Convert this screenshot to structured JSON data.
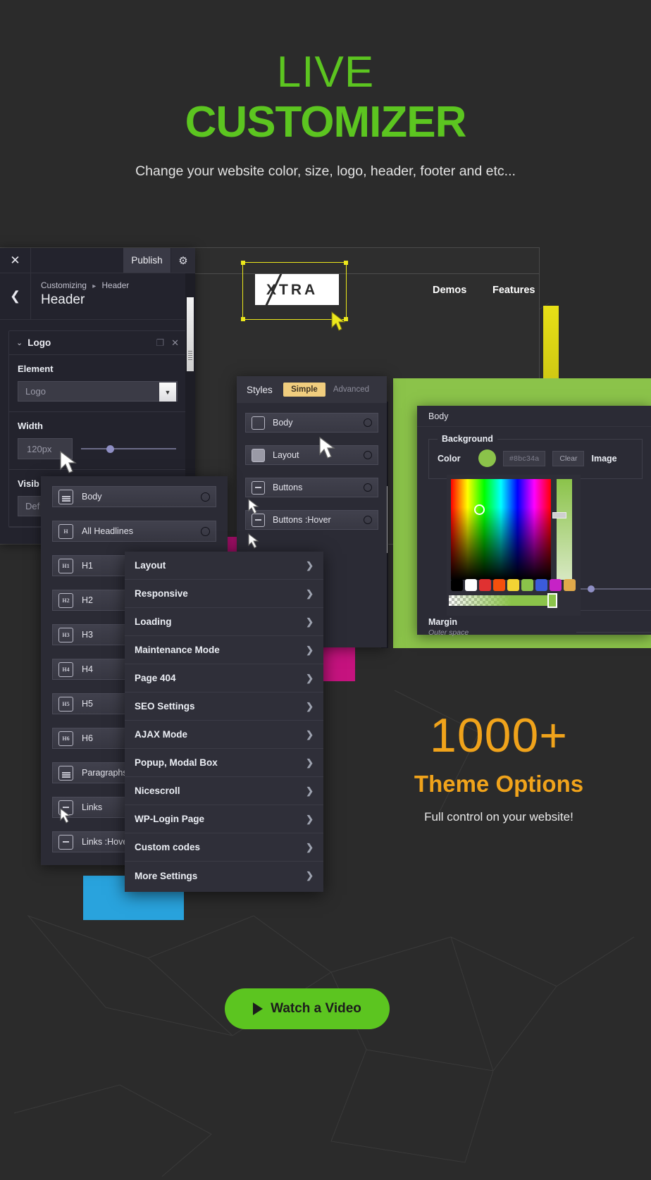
{
  "hero": {
    "line1": "LIVE",
    "line2": "CUSTOMIZER",
    "subtitle": "Change your website color, size, logo, header, footer and etc...",
    "accent_color": "#5cc520"
  },
  "site_preview": {
    "logo_text": "XTRA",
    "nav": [
      "Demos",
      "Features"
    ],
    "selection_color": "#ece81c"
  },
  "customizer": {
    "close_label": "✕",
    "publish_label": "Publish",
    "gear_icon": "gear-icon",
    "back_icon": "chevron-left-icon",
    "breadcrumb_root": "Customizing",
    "breadcrumb_sep": "▸",
    "breadcrumb_current": "Header",
    "panel_title": "Header",
    "section": {
      "name": "Logo",
      "collapse_icon": "chevron-down-icon",
      "duplicate_icon": "copy-icon",
      "delete_icon": "close-icon"
    },
    "fields": [
      {
        "label": "Element",
        "value": "Logo",
        "type": "select"
      },
      {
        "label": "Width",
        "value": "120px",
        "type": "slider"
      },
      {
        "label": "Visib",
        "value": "Def",
        "type": "select"
      }
    ]
  },
  "typography_panel": {
    "items": [
      {
        "label": "Body",
        "icon": "paragraph-lines-icon",
        "glyph": ""
      },
      {
        "label": "All Headlines",
        "icon": "heading-icon",
        "glyph": "H"
      },
      {
        "label": "H1",
        "icon": "heading-1-icon",
        "glyph": "H1"
      },
      {
        "label": "H2",
        "icon": "heading-2-icon",
        "glyph": "H2"
      },
      {
        "label": "H3",
        "icon": "heading-3-icon",
        "glyph": "H3"
      },
      {
        "label": "H4",
        "icon": "heading-4-icon",
        "glyph": "H4"
      },
      {
        "label": "H5",
        "icon": "heading-5-icon",
        "glyph": "H5"
      },
      {
        "label": "H6",
        "icon": "heading-6-icon",
        "glyph": "H6"
      },
      {
        "label": "Paragraphs",
        "icon": "paragraph-lines-icon",
        "glyph": ""
      },
      {
        "label": "Links",
        "icon": "link-dash-icon",
        "glyph": "-"
      },
      {
        "label": "Links :Hover",
        "icon": "link-dash-icon",
        "glyph": "-"
      }
    ]
  },
  "settings_menu": {
    "items": [
      "Layout",
      "Responsive",
      "Loading",
      "Maintenance Mode",
      "Page 404",
      "SEO Settings",
      "AJAX Mode",
      "Popup, Modal Box",
      "Nicescroll",
      "WP-Login Page",
      "Custom codes",
      "More Settings"
    ],
    "chevron": "❯"
  },
  "styles_panel": {
    "title": "Styles",
    "tabs": [
      {
        "label": "Simple",
        "active": true
      },
      {
        "label": "Advanced",
        "active": false
      }
    ],
    "active_tab_color": "#f0cd7e",
    "items": [
      {
        "label": "Body",
        "icon": "square-outline-icon"
      },
      {
        "label": "Layout",
        "icon": "square-filled-icon"
      },
      {
        "label": "Buttons",
        "icon": "button-dash-icon"
      },
      {
        "label": "Buttons :Hover",
        "icon": "button-dash-icon"
      }
    ]
  },
  "body_panel": {
    "title": "Body",
    "background_legend": "Background",
    "color_label": "Color",
    "color_value": "#8bc34a",
    "clear_label": "Clear",
    "image_label": "Image",
    "margin_label": "Margin",
    "margin_sub": "Outer space",
    "swatches": [
      "#000000",
      "#ffffff",
      "#e03131",
      "#f4500d",
      "#f2d434",
      "#8bc34a",
      "#3b5bdb",
      "#c622c6",
      "#e0a94a"
    ]
  },
  "promo": {
    "number": "1000+",
    "title": "Theme Options",
    "subtitle": "Full control on your website!",
    "color": "#f0a31b"
  },
  "cta": {
    "label": "Watch a Video",
    "icon": "play-icon",
    "color": "#5cc520"
  }
}
